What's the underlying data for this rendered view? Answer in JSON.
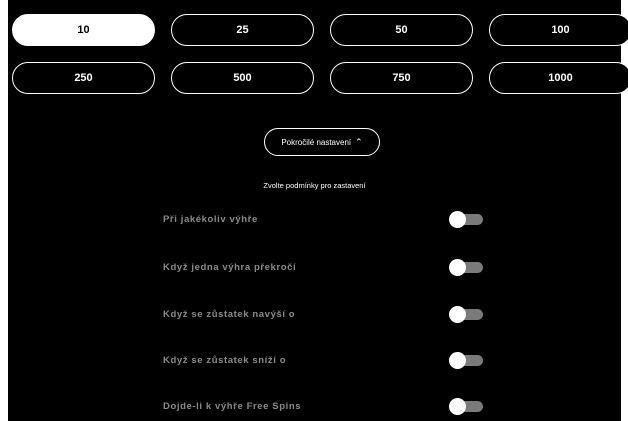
{
  "amounts": {
    "row1": [
      "10",
      "25",
      "50",
      "100"
    ],
    "row2": [
      "250",
      "500",
      "750",
      "1000"
    ],
    "selected": "10"
  },
  "advanced_settings": {
    "label": "Pokročilé nastavení",
    "chevron_icon": "chevron-up-icon"
  },
  "conditions": {
    "title": "Zvolte podmínky pro zastavení",
    "options": [
      {
        "label": "Při jakékoliv výhře",
        "enabled": false
      },
      {
        "label": "Když jedna výhra překročí",
        "enabled": false
      },
      {
        "label": "Když se zůstatek navýší o",
        "enabled": false
      },
      {
        "label": "Když se zůstatek sníží o",
        "enabled": false
      },
      {
        "label": "Dojde-li k výhře Free Spins",
        "enabled": false
      }
    ]
  },
  "colors": {
    "background": "#000000",
    "accent": "#ffffff",
    "muted_text": "#8a8a8a",
    "toggle_track": "#7a7a7a"
  }
}
